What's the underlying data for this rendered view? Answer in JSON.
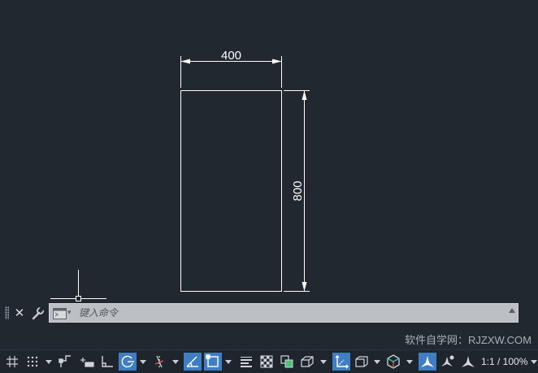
{
  "drawing": {
    "dimension_horizontal": "400",
    "dimension_vertical": "800"
  },
  "command_line": {
    "placeholder": "键入命令"
  },
  "watermark": "软件自学网：RJZXW.COM",
  "status_bar": {
    "scale_label": "1:1 / 100%",
    "buttons": [
      {
        "name": "grid-display",
        "icon": "grid-icon",
        "active": false
      },
      {
        "name": "snap-mode",
        "icon": "snap-dots-icon",
        "active": false
      },
      {
        "name": "infer-constraints",
        "icon": "infer-icon",
        "active": false
      },
      {
        "name": "dynamic-input",
        "icon": "dynamic-input-icon",
        "active": false
      },
      {
        "name": "ortho-mode",
        "icon": "ortho-icon",
        "active": false
      },
      {
        "name": "polar-tracking",
        "icon": "polar-icon",
        "active": true
      },
      {
        "name": "isometric-drafting",
        "icon": "isometric-icon",
        "active": false
      },
      {
        "name": "object-snap-tracking",
        "icon": "snap-tracking-icon",
        "active": true
      },
      {
        "name": "object-snap",
        "icon": "osnap-icon",
        "active": true
      },
      {
        "name": "lineweight",
        "icon": "lineweight-icon",
        "active": false
      },
      {
        "name": "transparency",
        "icon": "transparency-icon",
        "active": false
      },
      {
        "name": "selection-cycling",
        "icon": "selection-cycling-icon",
        "active": false
      },
      {
        "name": "3d-object-snap",
        "icon": "3d-osnap-icon",
        "active": false
      },
      {
        "name": "dynamic-ucs",
        "icon": "ucs-icon",
        "active": true
      },
      {
        "name": "selection-filter",
        "icon": "selection-filter-icon",
        "active": false
      },
      {
        "name": "gizmo",
        "icon": "gizmo-icon",
        "active": false
      },
      {
        "name": "annotation-visibility",
        "icon": "annotation-visibility-icon",
        "active": true
      },
      {
        "name": "auto-scale",
        "icon": "auto-scale-icon",
        "active": false
      },
      {
        "name": "annotation-scale",
        "icon": "annotation-scale-icon",
        "active": false
      }
    ],
    "active_color": "#3f7ec3"
  },
  "colors": {
    "background": "#212830",
    "geometry": "#ffffff"
  }
}
